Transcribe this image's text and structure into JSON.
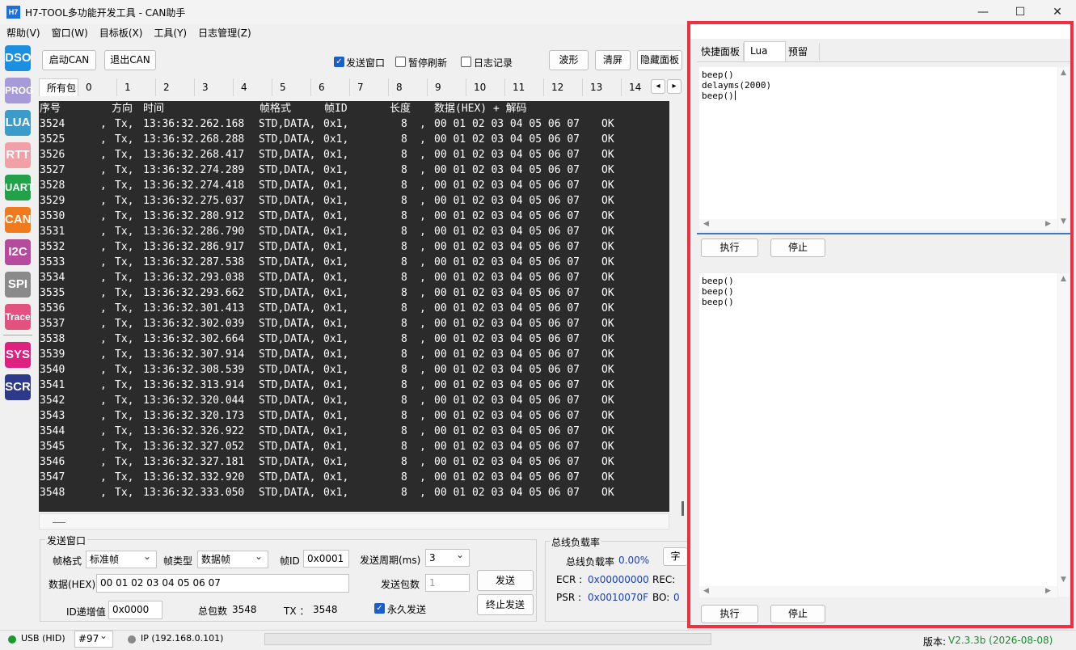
{
  "window": {
    "logo": "H7",
    "title": "H7-TOOL多功能开发工具 - CAN助手",
    "minimize": "—",
    "maximize": "☐",
    "close": "✕"
  },
  "menu": [
    "帮助(V)",
    "窗口(W)",
    "目标板(X)",
    "工具(Y)",
    "日志管理(Z)"
  ],
  "nav": [
    {
      "label": "DSO",
      "color": "#1d8fe0"
    },
    {
      "label": "PROG",
      "color": "#a79ad8"
    },
    {
      "label": "LUA",
      "color": "#3b9bc9"
    },
    {
      "label": "RTT",
      "color": "#f2a0a8"
    },
    {
      "label": "UART",
      "color": "#22a14a"
    },
    {
      "label": "CAN",
      "color": "#f07a1c"
    },
    {
      "label": "I2C",
      "color": "#b64a9c"
    },
    {
      "label": "SPI",
      "color": "#8a8a8a"
    },
    {
      "label": "Trace",
      "color": "#e3527f"
    },
    {
      "label": "SYS",
      "color": "#e0207f"
    },
    {
      "label": "SCR",
      "color": "#2d3a8c"
    }
  ],
  "toolbar": {
    "start_can": "启动CAN",
    "exit_can": "退出CAN",
    "send_window": "发送窗口",
    "pause_refresh": "暂停刷新",
    "log_record": "日志记录",
    "waveform": "波形",
    "clear": "清屏",
    "hide_panel": "隐藏面板"
  },
  "channel_tabs": [
    "所有包",
    "0",
    "1",
    "2",
    "3",
    "4",
    "5",
    "6",
    "7",
    "8",
    "9",
    "10",
    "11",
    "12",
    "13",
    "14"
  ],
  "scroll_arrows": {
    "left": "◂",
    "right": "▸"
  },
  "log": {
    "headers": {
      "seq": "序号",
      "dir": "方向",
      "time": "时间",
      "fmt": "帧格式",
      "id": "帧ID",
      "len": "长度",
      "data": "数据(HEX) + 解码"
    },
    "rows": [
      {
        "seq": "3524",
        "time": "13:36:32.262.168"
      },
      {
        "seq": "3525",
        "time": "13:36:32.268.288"
      },
      {
        "seq": "3526",
        "time": "13:36:32.268.417"
      },
      {
        "seq": "3527",
        "time": "13:36:32.274.289"
      },
      {
        "seq": "3528",
        "time": "13:36:32.274.418"
      },
      {
        "seq": "3529",
        "time": "13:36:32.275.037"
      },
      {
        "seq": "3530",
        "time": "13:36:32.280.912"
      },
      {
        "seq": "3531",
        "time": "13:36:32.286.790"
      },
      {
        "seq": "3532",
        "time": "13:36:32.286.917"
      },
      {
        "seq": "3533",
        "time": "13:36:32.287.538"
      },
      {
        "seq": "3534",
        "time": "13:36:32.293.038"
      },
      {
        "seq": "3535",
        "time": "13:36:32.293.662"
      },
      {
        "seq": "3536",
        "time": "13:36:32.301.413"
      },
      {
        "seq": "3537",
        "time": "13:36:32.302.039"
      },
      {
        "seq": "3538",
        "time": "13:36:32.302.664"
      },
      {
        "seq": "3539",
        "time": "13:36:32.307.914"
      },
      {
        "seq": "3540",
        "time": "13:36:32.308.539"
      },
      {
        "seq": "3541",
        "time": "13:36:32.313.914"
      },
      {
        "seq": "3542",
        "time": "13:36:32.320.044"
      },
      {
        "seq": "3543",
        "time": "13:36:32.320.173"
      },
      {
        "seq": "3544",
        "time": "13:36:32.326.922"
      },
      {
        "seq": "3545",
        "time": "13:36:32.327.052"
      },
      {
        "seq": "3546",
        "time": "13:36:32.327.181"
      },
      {
        "seq": "3547",
        "time": "13:36:32.332.920"
      },
      {
        "seq": "3548",
        "time": "13:36:32.333.050"
      }
    ],
    "common": {
      "dir": "Tx,",
      "fmt": "STD,DATA,",
      "id": "0x1,",
      "len": "8",
      "data": "00 01 02 03 04 05 06 07",
      "decode": "OK"
    }
  },
  "send": {
    "group_title": "发送窗口",
    "frame_format_label": "帧格式",
    "frame_format_value": "标准帧",
    "frame_type_label": "帧类型",
    "frame_type_value": "数据帧",
    "frame_id_label": "帧ID",
    "frame_id_value": "0x0001",
    "period_label": "发送周期(ms)",
    "period_value": "3",
    "data_label": "数据(HEX)",
    "data_value": "00 01 02 03 04 05 06 07",
    "count_label": "发送包数",
    "count_value": "1",
    "send_button": "发送",
    "id_inc_label": "ID递增值",
    "id_inc_value": "0x0000",
    "total_label": "总包数",
    "total_value": "3548",
    "tx_label": "TX ：",
    "tx_value": "3548",
    "forever_label": "永久发送",
    "stop_button": "终止发送"
  },
  "busload": {
    "group_title": "总线负载率",
    "load_label": "总线负载率",
    "load_value": "0.00%",
    "ecr_label": "ECR :",
    "ecr_value": "0x00000000",
    "rec_label": "REC:",
    "psr_label": "PSR :",
    "psr_value": "0x0010070F",
    "bo_label": "BO:",
    "bo_value": "0",
    "font_button": "字"
  },
  "right_panel": {
    "tabs": [
      "快捷面板",
      "Lua",
      "预留"
    ],
    "editor_lines": [
      "beep()",
      "delayms(2000)",
      "beep()"
    ],
    "run_button": "执行",
    "stop_button": "停止",
    "output_lines": [
      "beep()",
      "beep()",
      "beep()"
    ],
    "run_button2": "执行",
    "stop_button2": "停止"
  },
  "status": {
    "usb": "USB (HID)",
    "device": "#97",
    "ip": "IP (192.168.0.101)",
    "version_label": "版本:",
    "version_value": "V2.3.3b (2026-08-08)"
  }
}
